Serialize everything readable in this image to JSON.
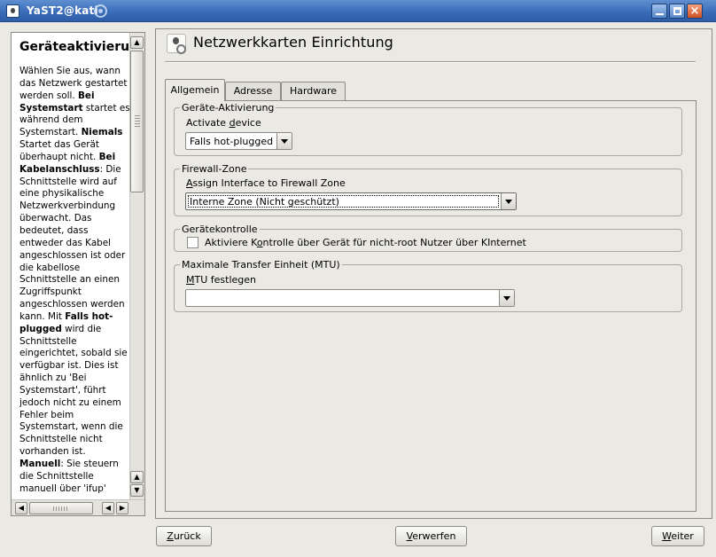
{
  "window": {
    "title": "YaST2@kati"
  },
  "help": {
    "heading": "Geräteaktivierung",
    "segments": [
      {
        "text": "Wählen Sie aus, wann das Netzwerk gestartet werden soll. ",
        "bold": false
      },
      {
        "text": "Bei Systemstart",
        "bold": true
      },
      {
        "text": " startet es während dem Systemstart. ",
        "bold": false
      },
      {
        "text": "Niemals",
        "bold": true
      },
      {
        "text": " Startet das Gerät überhaupt nicht. ",
        "bold": false
      },
      {
        "text": "Bei Kabelanschluss",
        "bold": true
      },
      {
        "text": ": Die Schnittstelle wird auf eine physikalische Netzwerkverbindung überwacht. Das bedeutet, dass entweder das Kabel angeschlossen ist oder die kabellose Schnittstelle an einen Zugriffspunkt angeschlossen werden kann. Mit ",
        "bold": false
      },
      {
        "text": "Falls hot-plugged",
        "bold": true
      },
      {
        "text": " wird die Schnittstelle eingerichtet, sobald sie verfügbar ist. Dies ist ähnlich zu 'Bei Systemstart', führt jedoch nicht zu einem Fehler beim Systemstart, wenn die Schnittstelle nicht vorhanden ist. ",
        "bold": false
      },
      {
        "text": "Manuell",
        "bold": true
      },
      {
        "text": ": Sie steuern die Schnittstelle manuell über 'ifup'",
        "bold": false
      }
    ]
  },
  "main": {
    "title": "Netzwerkkarten Einrichtung",
    "tabs": [
      {
        "label": "Allgemein",
        "active": true
      },
      {
        "label": "Adresse",
        "active": false
      },
      {
        "label": "Hardware",
        "active": false
      }
    ],
    "activation": {
      "legend": "Geräte-Aktivierung",
      "label_before": "Activate ",
      "label_mnemonic": "d",
      "label_after": "evice",
      "value": "Falls hot-plugged"
    },
    "firewall": {
      "legend": "Firewall-Zone",
      "label_mnemonic": "A",
      "label_after": "ssign Interface to Firewall Zone",
      "value": "Interne Zone (Nicht geschützt)"
    },
    "control": {
      "legend": "Gerätekontrolle",
      "label_before": "Aktiviere K",
      "label_mnemonic": "o",
      "label_after": "ntrolle über Gerät für nicht-root Nutzer über KInternet",
      "checked": false
    },
    "mtu": {
      "legend": "Maximale Transfer Einheit (MTU)",
      "label_mnemonic": "M",
      "label_after": "TU festlegen",
      "value": ""
    }
  },
  "buttons": {
    "back": {
      "mnemonic": "Z",
      "rest": "urück"
    },
    "discard": {
      "mnemonic": "V",
      "rest": "erwerfen"
    },
    "next": {
      "mnemonic": "W",
      "rest": "eiter"
    }
  },
  "colors": {
    "titlebar": "#3a6cb8",
    "window_bg": "#ebe9e3"
  }
}
